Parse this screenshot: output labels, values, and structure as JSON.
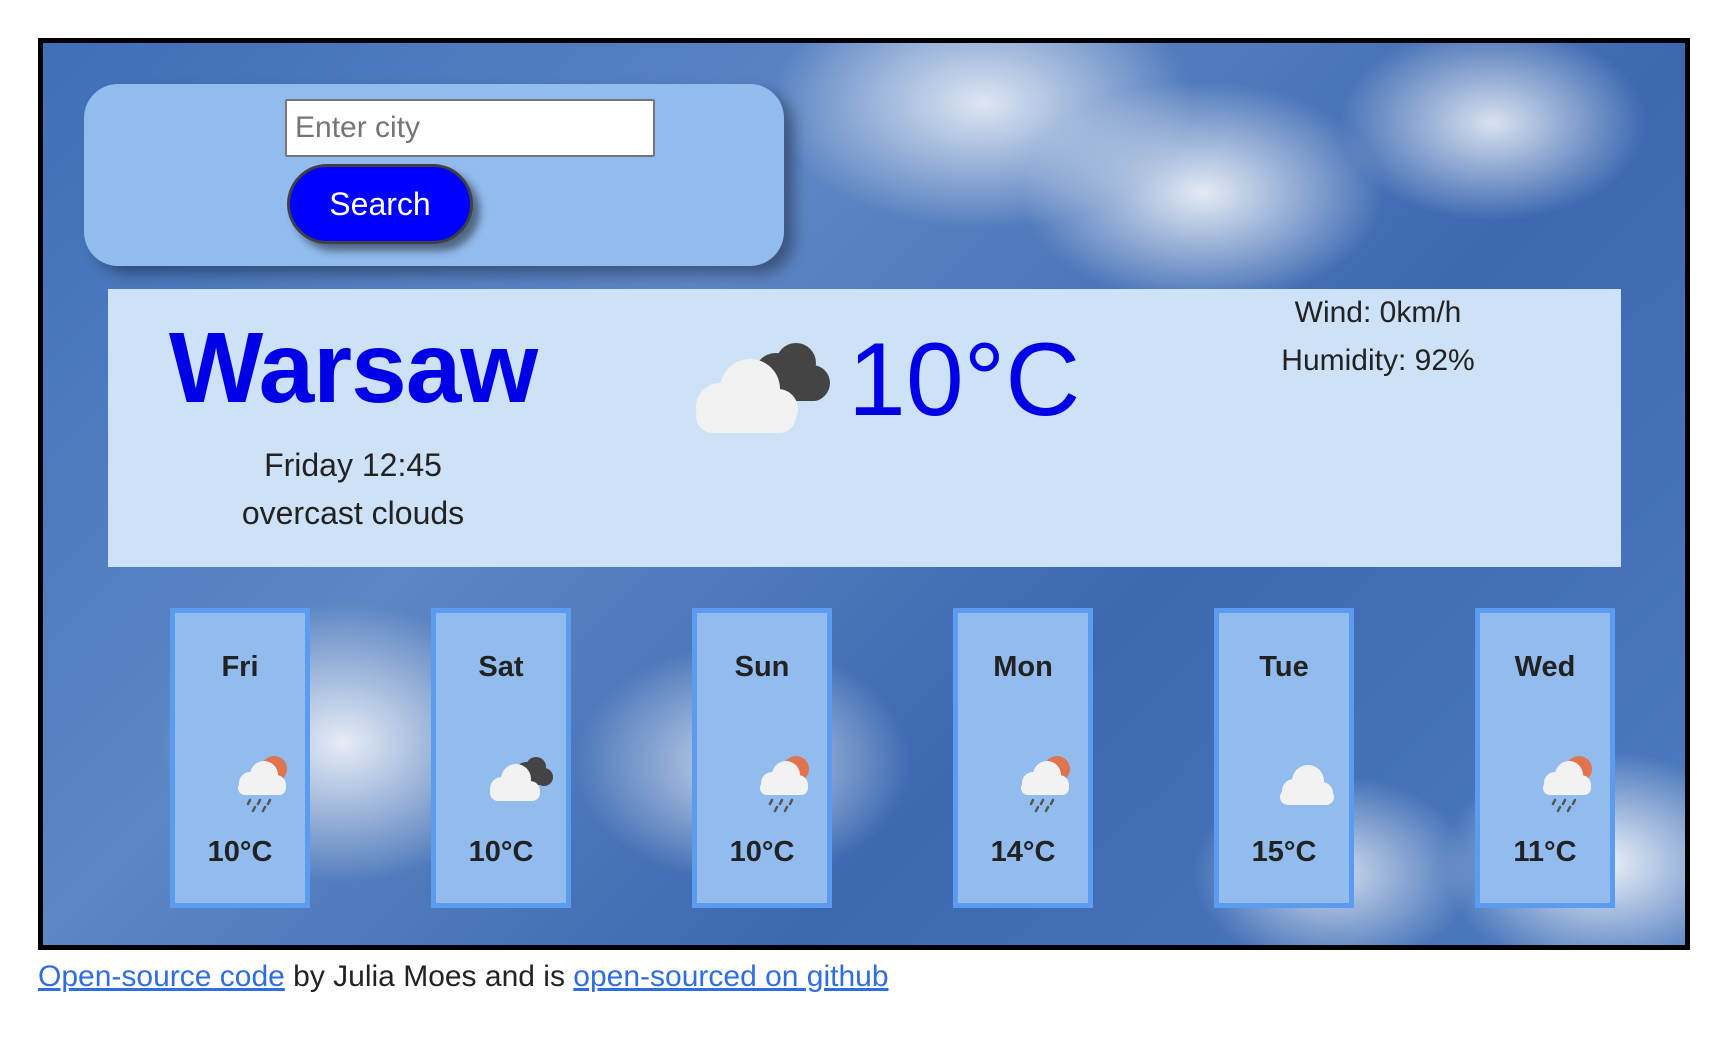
{
  "search": {
    "placeholder": "Enter city",
    "value": "",
    "button_label": "Search"
  },
  "current": {
    "city": "Warsaw",
    "datetime": "Friday 12:45",
    "description": "overcast clouds",
    "temperature": "10°C",
    "icon": "broken-clouds-icon",
    "wind": "Wind: 0km/h",
    "humidity": "Humidity: 92%"
  },
  "forecast": [
    {
      "day": "Fri",
      "icon": "light-rain-sun-icon",
      "temp": "10°C"
    },
    {
      "day": "Sat",
      "icon": "broken-clouds-icon",
      "temp": "10°C"
    },
    {
      "day": "Sun",
      "icon": "light-rain-sun-icon",
      "temp": "10°C"
    },
    {
      "day": "Mon",
      "icon": "light-rain-sun-icon",
      "temp": "14°C"
    },
    {
      "day": "Tue",
      "icon": "cloud-icon",
      "temp": "15°C"
    },
    {
      "day": "Wed",
      "icon": "light-rain-sun-icon",
      "temp": "11°C"
    }
  ],
  "footer": {
    "link1": "Open-source code",
    "text": " by Julia Moes and is ",
    "link2": "open-sourced on github"
  },
  "colors": {
    "accent_blue": "#0000ff",
    "panel_blue": "#92bbee",
    "current_panel": "#cde1f7",
    "card_border": "#5b9cf0"
  }
}
